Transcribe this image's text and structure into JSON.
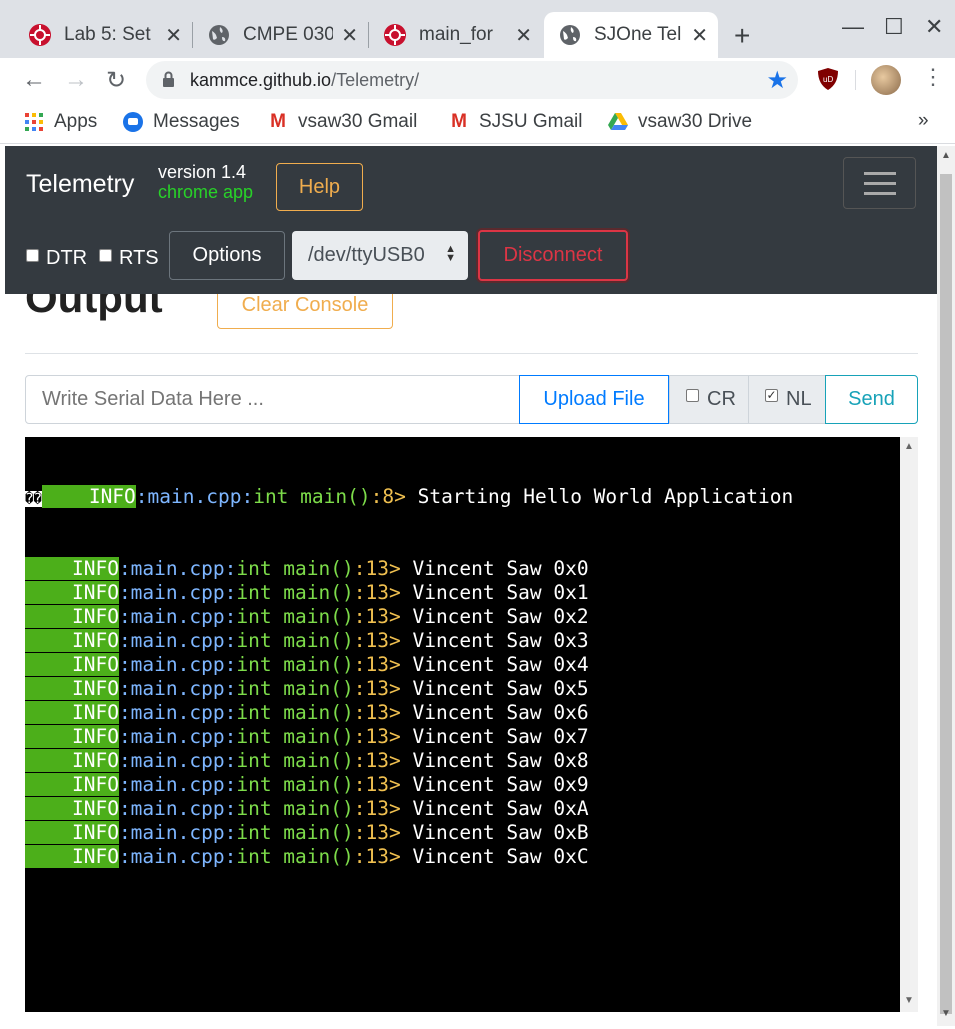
{
  "browser": {
    "tabs": [
      {
        "title": "Lab 5: Set",
        "icon": "sjsu-favicon-icon",
        "active": false
      },
      {
        "title": "CMPE 030",
        "icon": "globe-icon",
        "active": false
      },
      {
        "title": "main_for",
        "icon": "sjsu-favicon-icon",
        "active": false
      },
      {
        "title": "SJOne Tel",
        "icon": "globe-icon",
        "active": true
      }
    ],
    "url_host": "kammce.github.io",
    "url_path": "/Telemetry/",
    "bookmarks": [
      {
        "label": "Apps",
        "icon": "apps-grid-icon"
      },
      {
        "label": "Messages",
        "icon": "messages-icon"
      },
      {
        "label": "vsaw30 Gmail",
        "icon": "gmail-icon"
      },
      {
        "label": "SJSU Gmail",
        "icon": "gmail-icon"
      },
      {
        "label": "vsaw30 Drive",
        "icon": "drive-icon"
      }
    ],
    "bookmarks_overflow": "»"
  },
  "app": {
    "brand": "Telemetry",
    "version": "version 1.4",
    "subtitle": "chrome app",
    "help_label": "Help",
    "dtr_label": "DTR",
    "rts_label": "RTS",
    "options_label": "Options",
    "port_value": "/dev/ttyUSB0",
    "disconnect_label": "Disconnect",
    "output_heading": "Output",
    "clear_label": "Clear Console",
    "serial_placeholder": "Write Serial Data Here ...",
    "upload_label": "Upload File",
    "cr_label": "CR",
    "cr_checked": false,
    "nl_label": "NL",
    "nl_checked": true,
    "send_label": "Send"
  },
  "console": {
    "first_line": {
      "prefix": "��",
      "level": "INFO",
      "file": ":main.cpp:",
      "func": "int main()",
      "line": ":8>",
      "message": " Starting Hello World Application"
    },
    "lines": [
      {
        "level": "INFO",
        "file": ":main.cpp:",
        "func": "int main()",
        "line": ":13>",
        "message": " Vincent Saw 0x0"
      },
      {
        "level": "INFO",
        "file": ":main.cpp:",
        "func": "int main()",
        "line": ":13>",
        "message": " Vincent Saw 0x1"
      },
      {
        "level": "INFO",
        "file": ":main.cpp:",
        "func": "int main()",
        "line": ":13>",
        "message": " Vincent Saw 0x2"
      },
      {
        "level": "INFO",
        "file": ":main.cpp:",
        "func": "int main()",
        "line": ":13>",
        "message": " Vincent Saw 0x3"
      },
      {
        "level": "INFO",
        "file": ":main.cpp:",
        "func": "int main()",
        "line": ":13>",
        "message": " Vincent Saw 0x4"
      },
      {
        "level": "INFO",
        "file": ":main.cpp:",
        "func": "int main()",
        "line": ":13>",
        "message": " Vincent Saw 0x5"
      },
      {
        "level": "INFO",
        "file": ":main.cpp:",
        "func": "int main()",
        "line": ":13>",
        "message": " Vincent Saw 0x6"
      },
      {
        "level": "INFO",
        "file": ":main.cpp:",
        "func": "int main()",
        "line": ":13>",
        "message": " Vincent Saw 0x7"
      },
      {
        "level": "INFO",
        "file": ":main.cpp:",
        "func": "int main()",
        "line": ":13>",
        "message": " Vincent Saw 0x8"
      },
      {
        "level": "INFO",
        "file": ":main.cpp:",
        "func": "int main()",
        "line": ":13>",
        "message": " Vincent Saw 0x9"
      },
      {
        "level": "INFO",
        "file": ":main.cpp:",
        "func": "int main()",
        "line": ":13>",
        "message": " Vincent Saw 0xA"
      },
      {
        "level": "INFO",
        "file": ":main.cpp:",
        "func": "int main()",
        "line": ":13>",
        "message": " Vincent Saw 0xB"
      },
      {
        "level": "INFO",
        "file": ":main.cpp:",
        "func": "int main()",
        "line": ":13>",
        "message": " Vincent Saw 0xC"
      }
    ]
  },
  "colors": {
    "navbar": "#343a40",
    "help_border": "#f0ad4e",
    "disconnect": "#dc3545",
    "upload": "#007bff",
    "send": "#17a2b8",
    "console_level_bg": "#4caf1a"
  }
}
